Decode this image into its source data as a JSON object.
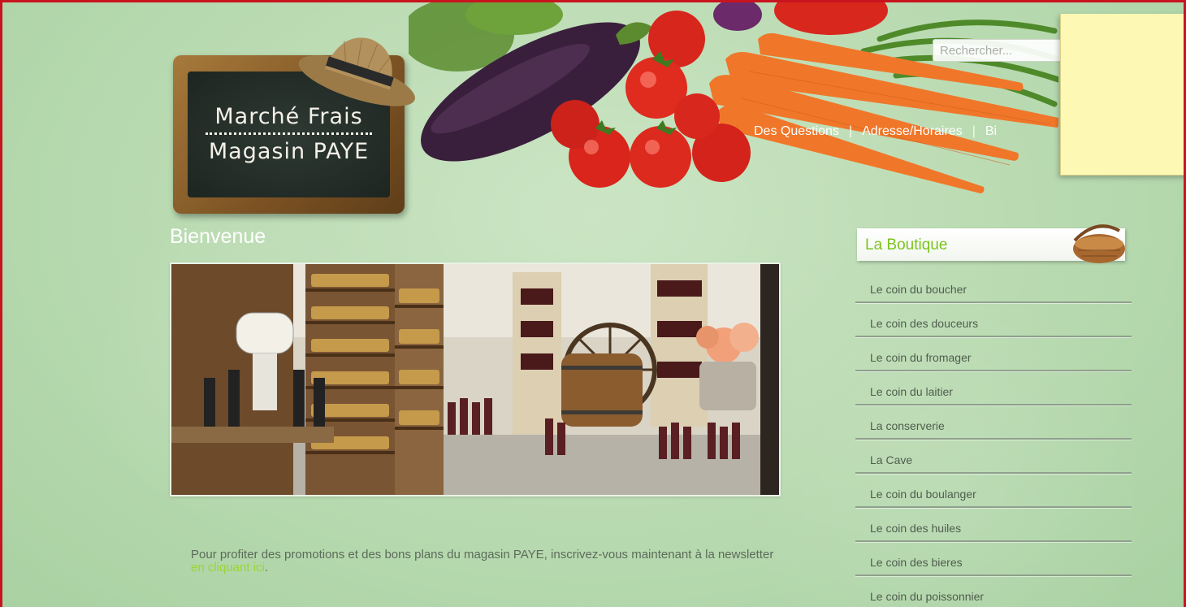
{
  "logo": {
    "line1": "Marché Frais",
    "line2": "Magasin PAYE"
  },
  "search": {
    "placeholder": "Rechercher..."
  },
  "topnav": {
    "items": [
      "Des Questions",
      "Adresse/Horaires",
      "Bi"
    ],
    "separator": "|"
  },
  "main": {
    "heading": "Bienvenue",
    "promo_text": "Pour profiter des promotions et des bons plans du magasin PAYE, inscrivez-vous maintenant à la newsletter ",
    "promo_link": "en cliquant ici",
    "promo_end": "."
  },
  "sidebar": {
    "title": "La Boutique",
    "items": [
      "Le coin du boucher",
      "Le coin des douceurs",
      "Le coin du fromager",
      "Le coin du laitier",
      "La conserverie",
      "La Cave",
      "Le coin du boulanger",
      "Le coin des huiles",
      "Le coin des bieres",
      "Le coin du poissonnier"
    ]
  },
  "colors": {
    "frame_border": "#c8141e",
    "accent_green": "#7cc31f",
    "link_green": "#9ad43a",
    "page_bg": "#bcdcb4",
    "note_yellow": "#fdf8b4"
  },
  "icons": {
    "hat": "straw-hat-icon",
    "basket": "basket-icon"
  }
}
